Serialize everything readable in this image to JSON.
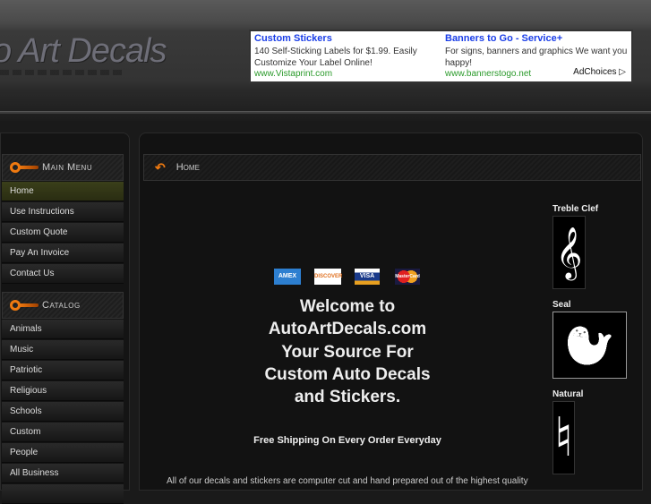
{
  "header": {
    "logo_text": "o Art Decals"
  },
  "ad": {
    "items": [
      {
        "title": "Custom Stickers",
        "desc": "140 Self-Sticking Labels for $1.99. Easily Customize Your Label Online!",
        "url": "www.Vistaprint.com"
      },
      {
        "title": "Banners to Go - Service+",
        "desc": "For signs, banners and graphics We want you happy!",
        "url": "www.bannerstogo.net"
      }
    ],
    "adchoices": "AdChoices"
  },
  "sidebar": {
    "main_menu": {
      "title": "Main Menu",
      "items": [
        "Home",
        "Use Instructions",
        "Custom Quote",
        "Pay An Invoice",
        "Contact Us"
      ]
    },
    "catalog": {
      "title": "Catalog",
      "items": [
        "Animals",
        "Music",
        "Patriotic",
        "Religious",
        "Schools",
        "Custom",
        "People",
        "All Business"
      ]
    }
  },
  "breadcrumb": {
    "label": "Home"
  },
  "payment_cards": [
    "AMEX",
    "DISCOVER",
    "VISA",
    "MasterCard"
  ],
  "content": {
    "welcome_lines": [
      "Welcome to",
      "AutoArtDecals.com",
      "Your Source For",
      "Custom Auto Decals",
      "and Stickers."
    ],
    "shipping": "Free Shipping On Every Order Everyday",
    "paragraph": "All of our decals and stickers are computer cut and hand prepared out of the highest quality"
  },
  "featured": [
    {
      "label": "Treble Clef",
      "glyph": "𝄞"
    },
    {
      "label": "Seal",
      "glyph": "🦭"
    },
    {
      "label": "Natural",
      "glyph": "♮"
    }
  ]
}
